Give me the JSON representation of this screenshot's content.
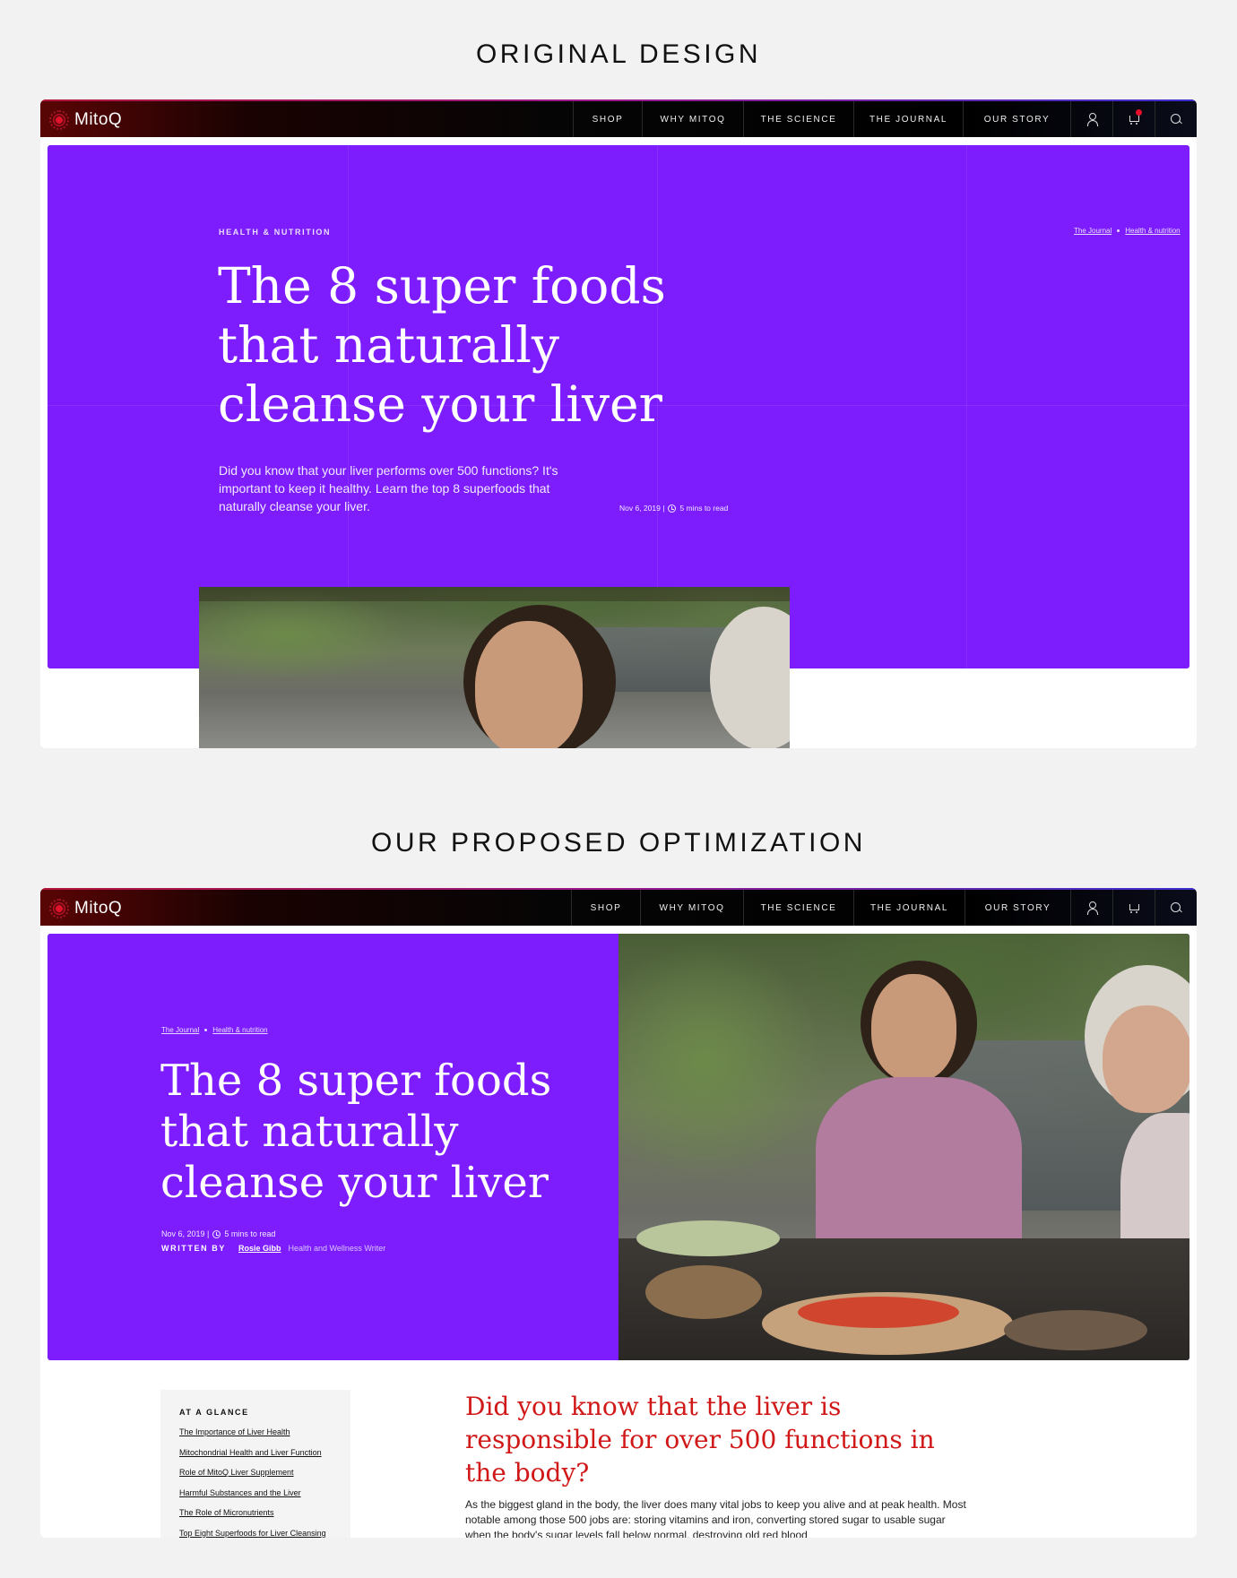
{
  "sections": {
    "original_title": "ORIGINAL DESIGN",
    "proposed_title": "OUR PROPOSED OPTIMIZATION"
  },
  "nav": {
    "logo": "MitoQ",
    "items": [
      "SHOP",
      "WHY MITOQ",
      "THE SCIENCE",
      "THE JOURNAL",
      "OUR STORY"
    ],
    "icons": [
      "user-icon",
      "cart-icon",
      "search-icon"
    ]
  },
  "original": {
    "kicker": "HEALTH & NUTRITION",
    "breadcrumb": [
      "The Journal",
      "Health & nutrition"
    ],
    "title_lines": [
      "The 8 super foods",
      "that naturally",
      "cleanse your liver"
    ],
    "dek": "Did you know that your liver performs over 500 functions? It's important to keep it healthy. Learn the top 8 superfoods that naturally cleanse your liver.",
    "date": "Nov 6, 2019 |",
    "read_time": "5 mins to read"
  },
  "proposed": {
    "breadcrumb": [
      "The Journal",
      "Health & nutrition"
    ],
    "title_lines": [
      "The 8 super foods",
      "that naturally",
      "cleanse your liver"
    ],
    "date": "Nov 6, 2019 |",
    "read_time": "5 mins to read",
    "written_by_label": "WRITTEN BY",
    "author": "Rosie Gibb",
    "author_role": "Health and Wellness Writer",
    "toc": {
      "title": "AT A GLANCE",
      "items": [
        "The Importance of Liver Health",
        "Mitochondrial Health and Liver Function",
        "Role of MitoQ Liver Supplement",
        "Harmful Substances and the Liver",
        "The Role of Micronutrients",
        "Top Eight Superfoods for Liver Cleansing"
      ]
    },
    "lead": "Did you know that the liver is responsible for over 500 functions in the body?",
    "body": "As the biggest gland in the body, the liver does many vital jobs to keep you alive and at peak health. Most notable among those 500 jobs are: storing vitamins and iron, converting stored sugar to usable sugar when the body's sugar levels fall below normal, destroying old red blood"
  },
  "colors": {
    "hero_purple": "#7d1dfd",
    "lead_red": "#d11818",
    "nav_dark": "#050505",
    "cart_badge": "#e8102a"
  }
}
